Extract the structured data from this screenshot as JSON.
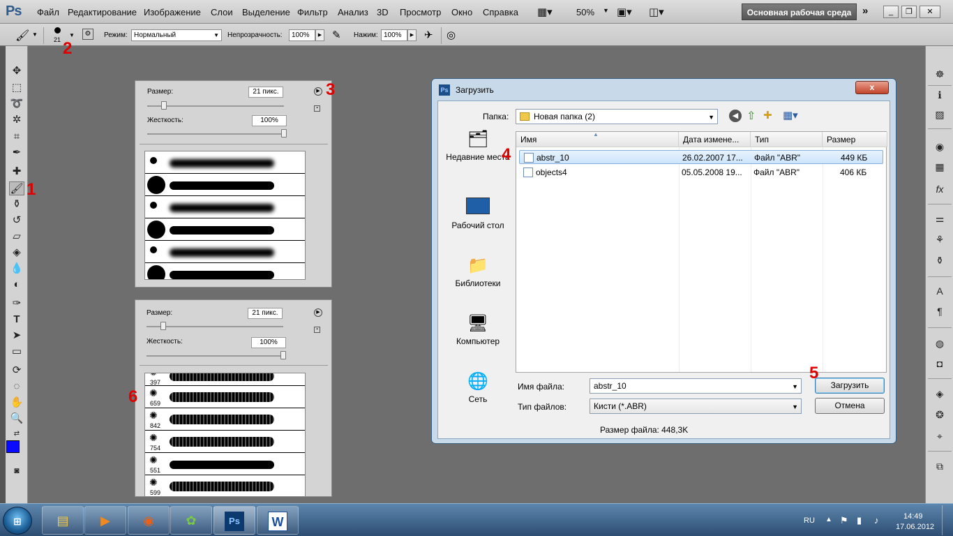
{
  "app": {
    "logo": "Ps",
    "menu": [
      "Файл",
      "Редактирование",
      "Изображение",
      "Слои",
      "Выделение",
      "Фильтр",
      "Анализ",
      "3D",
      "Просмотр",
      "Окно",
      "Справка"
    ],
    "zoom": "50%",
    "workspace": "Основная рабочая среда"
  },
  "options": {
    "brush_size": "21",
    "mode_label": "Режим:",
    "mode_value": "Нормальный",
    "opacity_label": "Непрозрачность:",
    "opacity_value": "100%",
    "flow_label": "Нажим:",
    "flow_value": "100%"
  },
  "brush_panel_1": {
    "size_label": "Размер:",
    "size_value": "21 пикс.",
    "hardness_label": "Жесткость:",
    "hardness_value": "100%",
    "size_fraction": 0.12,
    "hardness_fraction": 1.0
  },
  "brush_panel_2": {
    "size_label": "Размер:",
    "size_value": "21 пикс.",
    "hardness_label": "Жесткость:",
    "hardness_value": "100%",
    "size_fraction": 0.12,
    "hardness_fraction": 1.0,
    "items": [
      "397",
      "659",
      "842",
      "754",
      "551",
      "599"
    ]
  },
  "annotations": [
    "1",
    "2",
    "3",
    "4",
    "5",
    "6"
  ],
  "dialog": {
    "title": "Загрузить",
    "close": "x",
    "folder_label": "Папка:",
    "folder_value": "Новая папка (2)",
    "places": [
      "Недавние места",
      "Рабочий стол",
      "Библиотеки",
      "Компьютер",
      "Сеть"
    ],
    "columns": [
      "Имя",
      "Дата измене...",
      "Тип",
      "Размер"
    ],
    "files": [
      {
        "name": "abstr_10",
        "date": "26.02.2007 17...",
        "type": "Файл \"ABR\"",
        "size": "449 КБ"
      },
      {
        "name": "objects4",
        "date": "05.05.2008 19...",
        "type": "Файл \"ABR\"",
        "size": "406 КБ"
      }
    ],
    "filename_label": "Имя файла:",
    "filename_value": "abstr_10",
    "filetype_label": "Тип файлов:",
    "filetype_value": "Кисти (*.ABR)",
    "load_button": "Загрузить",
    "cancel_button": "Отмена",
    "filesize": "Размер файла: 448,3K"
  },
  "taskbar": {
    "lang": "RU",
    "time": "14:49",
    "date": "17.06.2012",
    "apps": [
      "Ps",
      "W"
    ]
  }
}
